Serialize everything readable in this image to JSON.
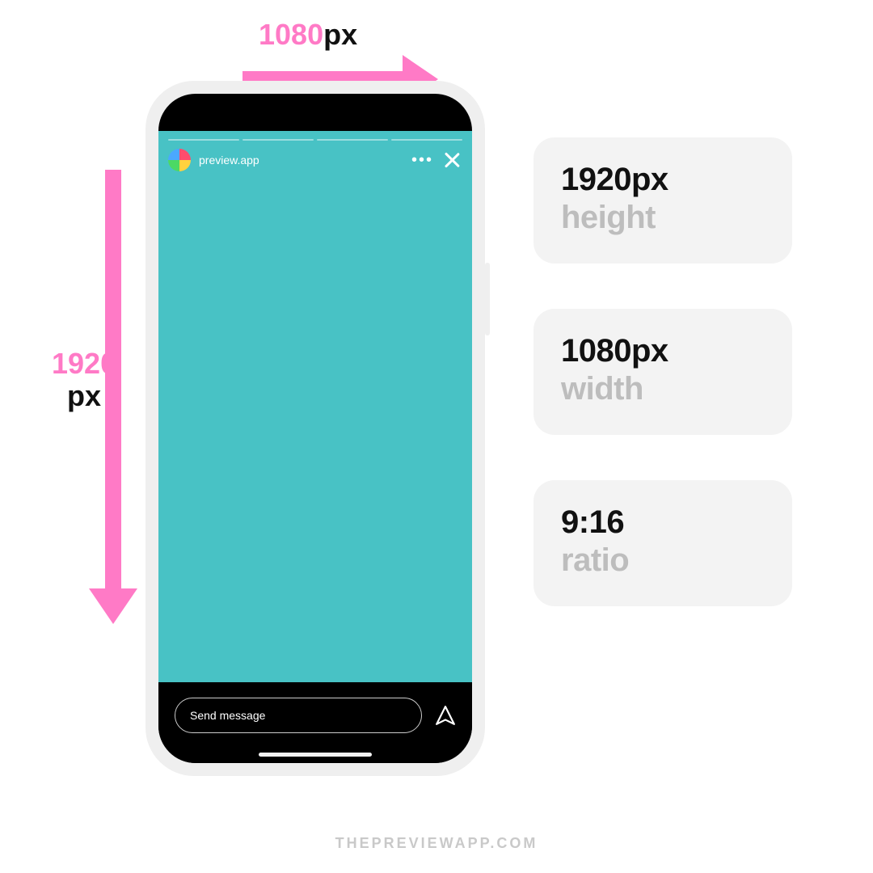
{
  "dimensions": {
    "width_label": "1080",
    "width_unit": "px",
    "height_label": "1920",
    "height_unit": "px"
  },
  "story": {
    "username": "preview.app",
    "message_placeholder": "Send message"
  },
  "cards": [
    {
      "value": "1920px",
      "label": "height"
    },
    {
      "value": "1080px",
      "label": "width"
    },
    {
      "value": "9:16",
      "label": "ratio"
    }
  ],
  "footer": "THEPREVIEWAPP.COM",
  "colors": {
    "accent_pink": "#ff7ac6",
    "story_bg": "#48c2c5",
    "card_bg": "#f3f3f3"
  }
}
